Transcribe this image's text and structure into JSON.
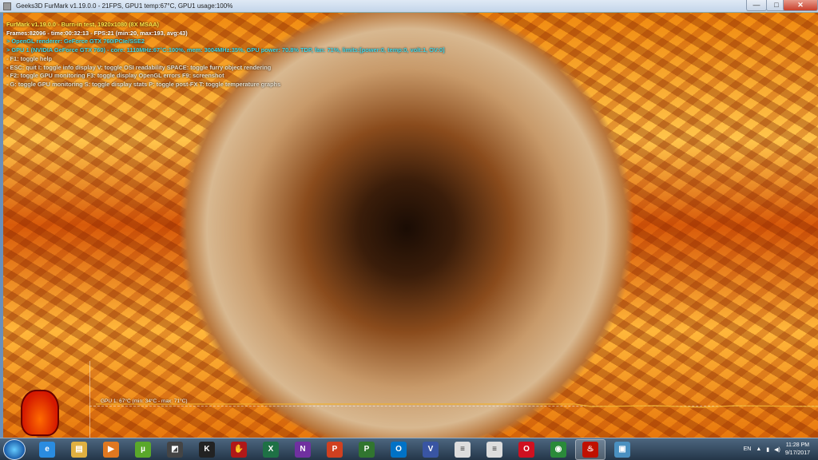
{
  "window": {
    "title": "Geeks3D FurMark v1.19.0.0 - 21FPS, GPU1 temp:67°C, GPU1 usage:100%",
    "minimize": "—",
    "maximize": "□",
    "close": "✕"
  },
  "overlay": {
    "lines": [
      "FurMark v1.19.0.0 - Burn-in test, 1920x1080 (8X MSAA)",
      "Frames:82096 - time:00:32:13 - FPS:21 (min:20, max:193, avg:43)",
      "> OpenGL renderer: GeForce GTX 760/PCIe/SSE2",
      "> GPU 1 (NVIDIA GeForce GTX 760) - core: 1110MHz:67°C:100%, mem: 3004MHz:35%, GPU power: 70.8% TDP, fan: 71%, limits:[power:0, temp:0, volt:1, OV:0]",
      "- F1: toggle help",
      "- ESC: quit   I: toggle info display   V: toggle OSI readability   SPACE: toggle furry object rendering",
      "- F2: toggle GPU monitoring   F3: toggle display OpenGL errors   F9: screenshot",
      "- G: toggle GPU monitoring   S: toggle display stats   P: toggle post-FX   T: toggle temperature graphs"
    ]
  },
  "graph": {
    "label": "GPU 1: 67°C (min: 34°C - max: 71°C)",
    "current_c": 67,
    "min_c": 34,
    "max_c": 71
  },
  "taskbar": {
    "apps": [
      {
        "name": "internet-explorer",
        "glyph": "e",
        "color": "#2a8ce0"
      },
      {
        "name": "file-explorer",
        "glyph": "▤",
        "color": "#e0b040"
      },
      {
        "name": "media-player",
        "glyph": "▶",
        "color": "#e07820"
      },
      {
        "name": "utorrent",
        "glyph": "µ",
        "color": "#5aa82a"
      },
      {
        "name": "gpu-tool",
        "glyph": "◩",
        "color": "#444"
      },
      {
        "name": "k-app",
        "glyph": "K",
        "color": "#222"
      },
      {
        "name": "bloody-mouse",
        "glyph": "✋",
        "color": "#b01818"
      },
      {
        "name": "excel",
        "glyph": "X",
        "color": "#1e7145"
      },
      {
        "name": "onenote",
        "glyph": "N",
        "color": "#7030a0"
      },
      {
        "name": "powerpoint",
        "glyph": "P",
        "color": "#d04020"
      },
      {
        "name": "project",
        "glyph": "P",
        "color": "#31752f"
      },
      {
        "name": "outlook",
        "glyph": "O",
        "color": "#0072c6"
      },
      {
        "name": "visio",
        "glyph": "V",
        "color": "#3955a3"
      },
      {
        "name": "document-1",
        "glyph": "≡",
        "color": "#ddd"
      },
      {
        "name": "document-2",
        "glyph": "≡",
        "color": "#ddd"
      },
      {
        "name": "opera",
        "glyph": "O",
        "color": "#d01020"
      },
      {
        "name": "media-app",
        "glyph": "◉",
        "color": "#2a8a3a"
      },
      {
        "name": "furmark",
        "glyph": "♨",
        "color": "#c01000",
        "active": true
      },
      {
        "name": "image-viewer",
        "glyph": "▣",
        "color": "#4a90c0"
      }
    ],
    "tray": {
      "language": "EN",
      "time": "11:28 PM",
      "date": "9/17/2017"
    }
  }
}
